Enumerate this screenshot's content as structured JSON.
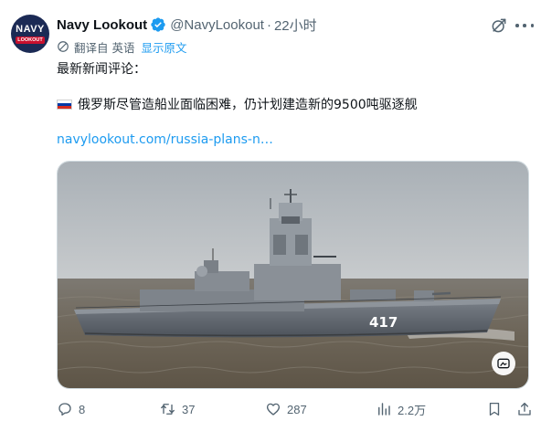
{
  "author": {
    "avatar_text_top": "NAVY",
    "avatar_text_bottom": "LOOKOUT",
    "display_name": "Navy Lookout",
    "handle": "@NavyLookout",
    "separator": "·",
    "time": "22小时"
  },
  "translation": {
    "label": "翻译自 英语",
    "show_original": "显示原文"
  },
  "tweet": {
    "line1": "最新新闻评论：",
    "line2": "俄罗斯尽管造船业面临困难，仍计划建造新的9500吨驱逐舰",
    "link": "navylookout.com/russia-plans-n…"
  },
  "media": {
    "hull_number": "417"
  },
  "actions": {
    "replies": "8",
    "retweets": "37",
    "likes": "287",
    "views": "2.2万"
  },
  "icons": {
    "verified": "verified-badge-icon",
    "grok": "grok-icon",
    "more": "more-icon",
    "translate": "translate-icon",
    "flag": "russia-flag-icon",
    "alt": "alt-text-icon",
    "reply": "reply-icon",
    "retweet": "retweet-icon",
    "like": "like-icon",
    "views": "views-icon",
    "bookmark": "bookmark-icon",
    "share": "share-icon"
  },
  "colors": {
    "accent": "#1d9bf0",
    "text": "#0f1419",
    "muted": "#536471",
    "avatar_bg": "#1b2a55",
    "avatar_badge": "#c8102e"
  }
}
